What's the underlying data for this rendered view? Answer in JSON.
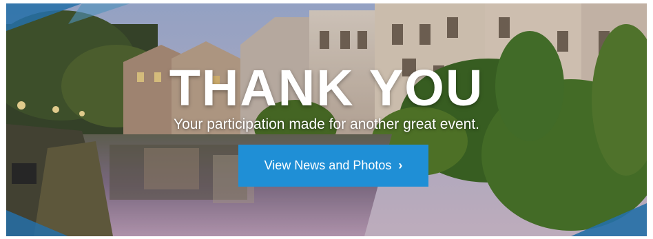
{
  "banner": {
    "headline": "THANK YOU",
    "subheadline": "Your participation made for another great event.",
    "cta_label": "View News and Photos",
    "cta_icon": "chevron-right-icon",
    "accent_color": "#1f8fd6"
  }
}
